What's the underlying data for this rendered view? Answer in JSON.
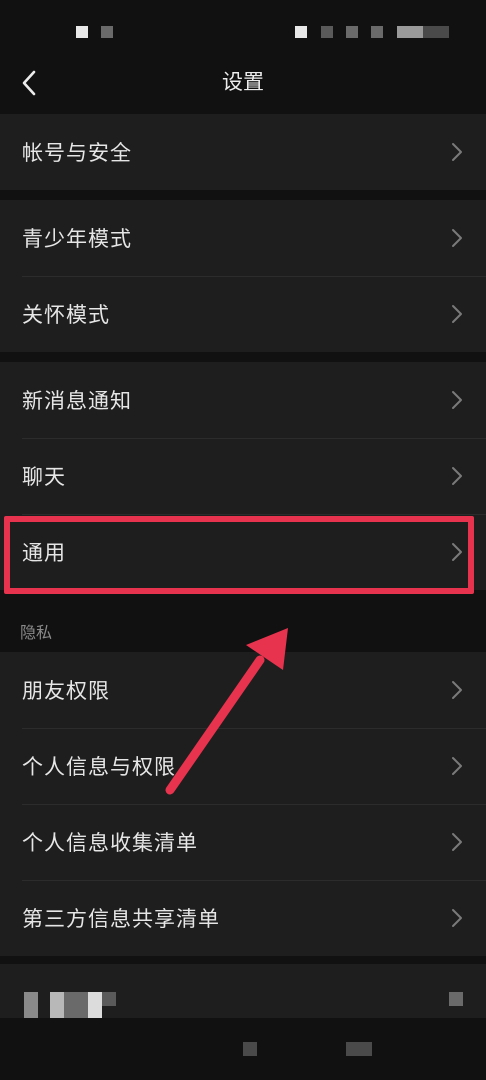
{
  "header": {
    "title": "设置",
    "back_icon": "chevron-left-icon"
  },
  "groups": [
    {
      "items": [
        {
          "label": "帐号与安全"
        }
      ]
    },
    {
      "items": [
        {
          "label": "青少年模式"
        },
        {
          "label": "关怀模式"
        }
      ]
    },
    {
      "items": [
        {
          "label": "新消息通知"
        },
        {
          "label": "聊天"
        },
        {
          "label": "通用"
        }
      ]
    },
    {
      "section_label": "隐私",
      "items": [
        {
          "label": "朋友权限"
        },
        {
          "label": "个人信息与权限"
        },
        {
          "label": "个人信息收集清单"
        },
        {
          "label": "第三方信息共享清单"
        }
      ]
    }
  ],
  "annotation": {
    "highlight_color": "#e8334e",
    "highlighted_item": "通用"
  },
  "colors": {
    "background": "#111111",
    "row": "#1e1e1e",
    "text": "#e6e6e6",
    "chevron": "#7a7a7a"
  }
}
